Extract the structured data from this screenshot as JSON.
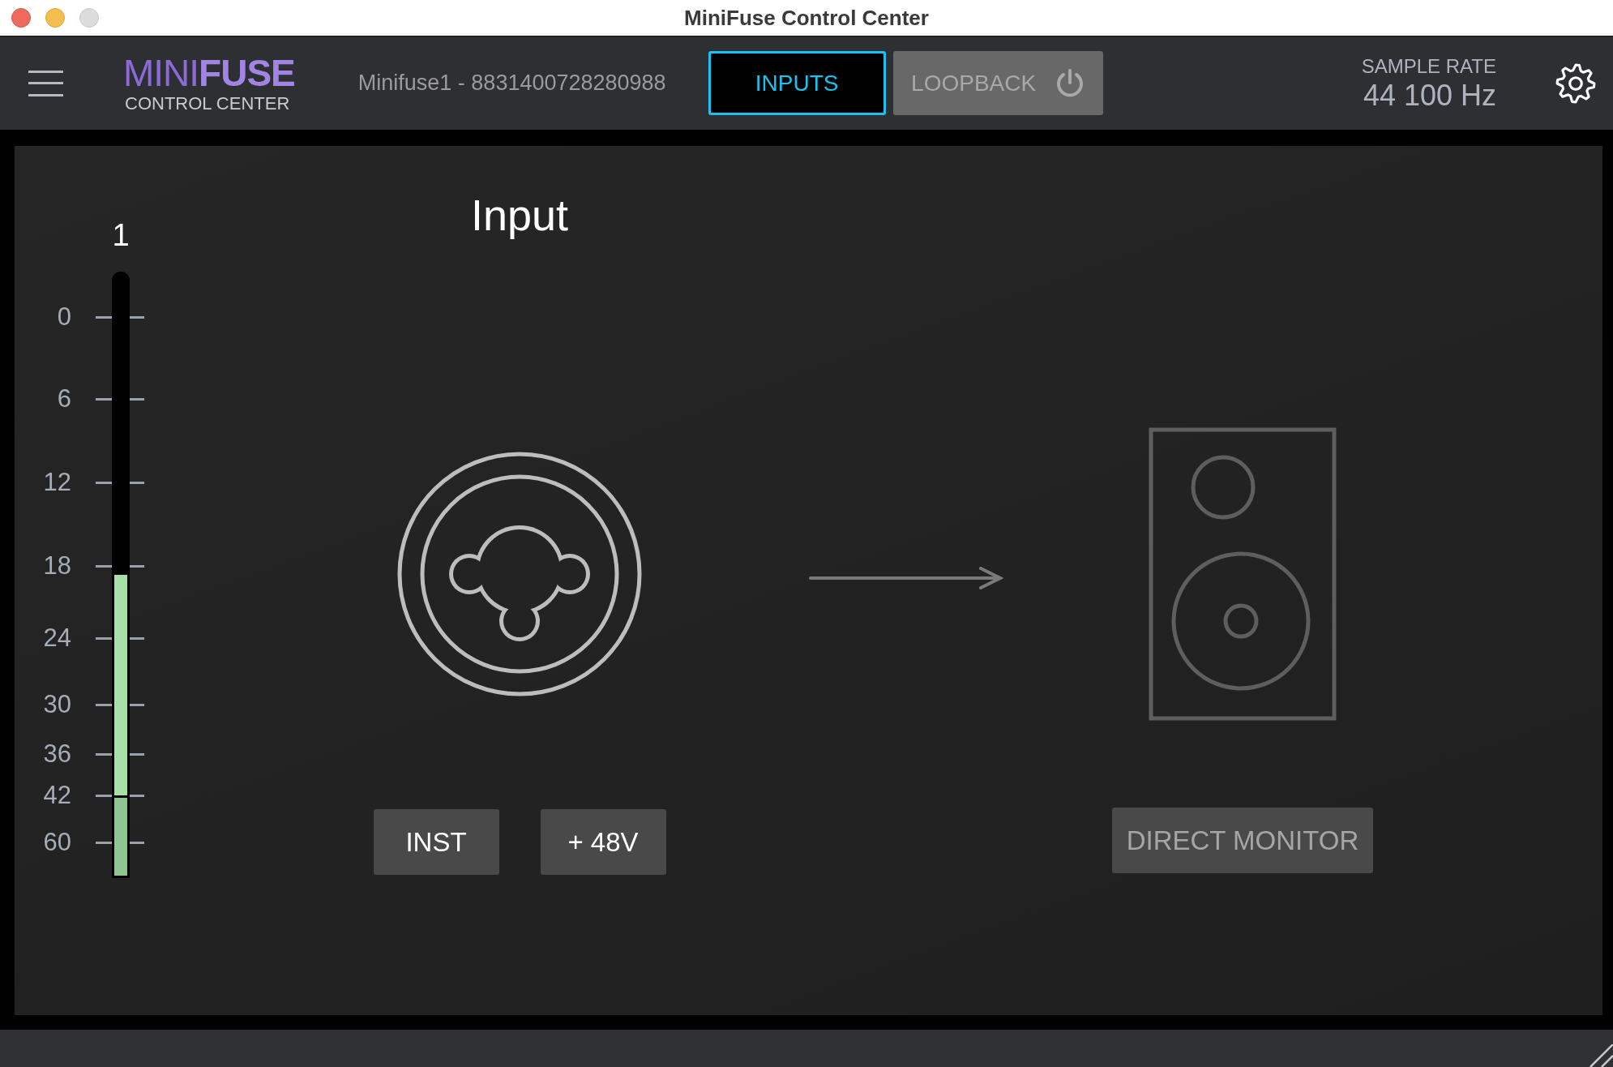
{
  "window": {
    "title": "MiniFuse Control Center"
  },
  "toolbar": {
    "logo": {
      "wordmark": "MINI**FUSE**",
      "subtitle": "CONTROL CENTER"
    },
    "device": "Minifuse1 - 8831400728280988",
    "tabs": [
      {
        "label": "INPUTS",
        "kind": "plain",
        "selected": true
      },
      {
        "label": "LOOPBACK",
        "kind": "toggle",
        "selected": false
      }
    ],
    "sample_rate": {
      "label": "SAMPLE RATE",
      "value": "44 100 Hz"
    }
  },
  "meter": {
    "channel": "1",
    "scale": [
      "0",
      "6",
      "12",
      "18",
      "24",
      "30",
      "36",
      "42",
      "60"
    ],
    "level": 0.5
  },
  "input": {
    "title": "Input",
    "buttons": [
      {
        "label": "INST",
        "disabled": false
      },
      {
        "label": "+ 48V",
        "disabled": false
      }
    ]
  },
  "monitor": {
    "button": {
      "label": "DIRECT MONITOR",
      "disabled": true
    }
  }
}
